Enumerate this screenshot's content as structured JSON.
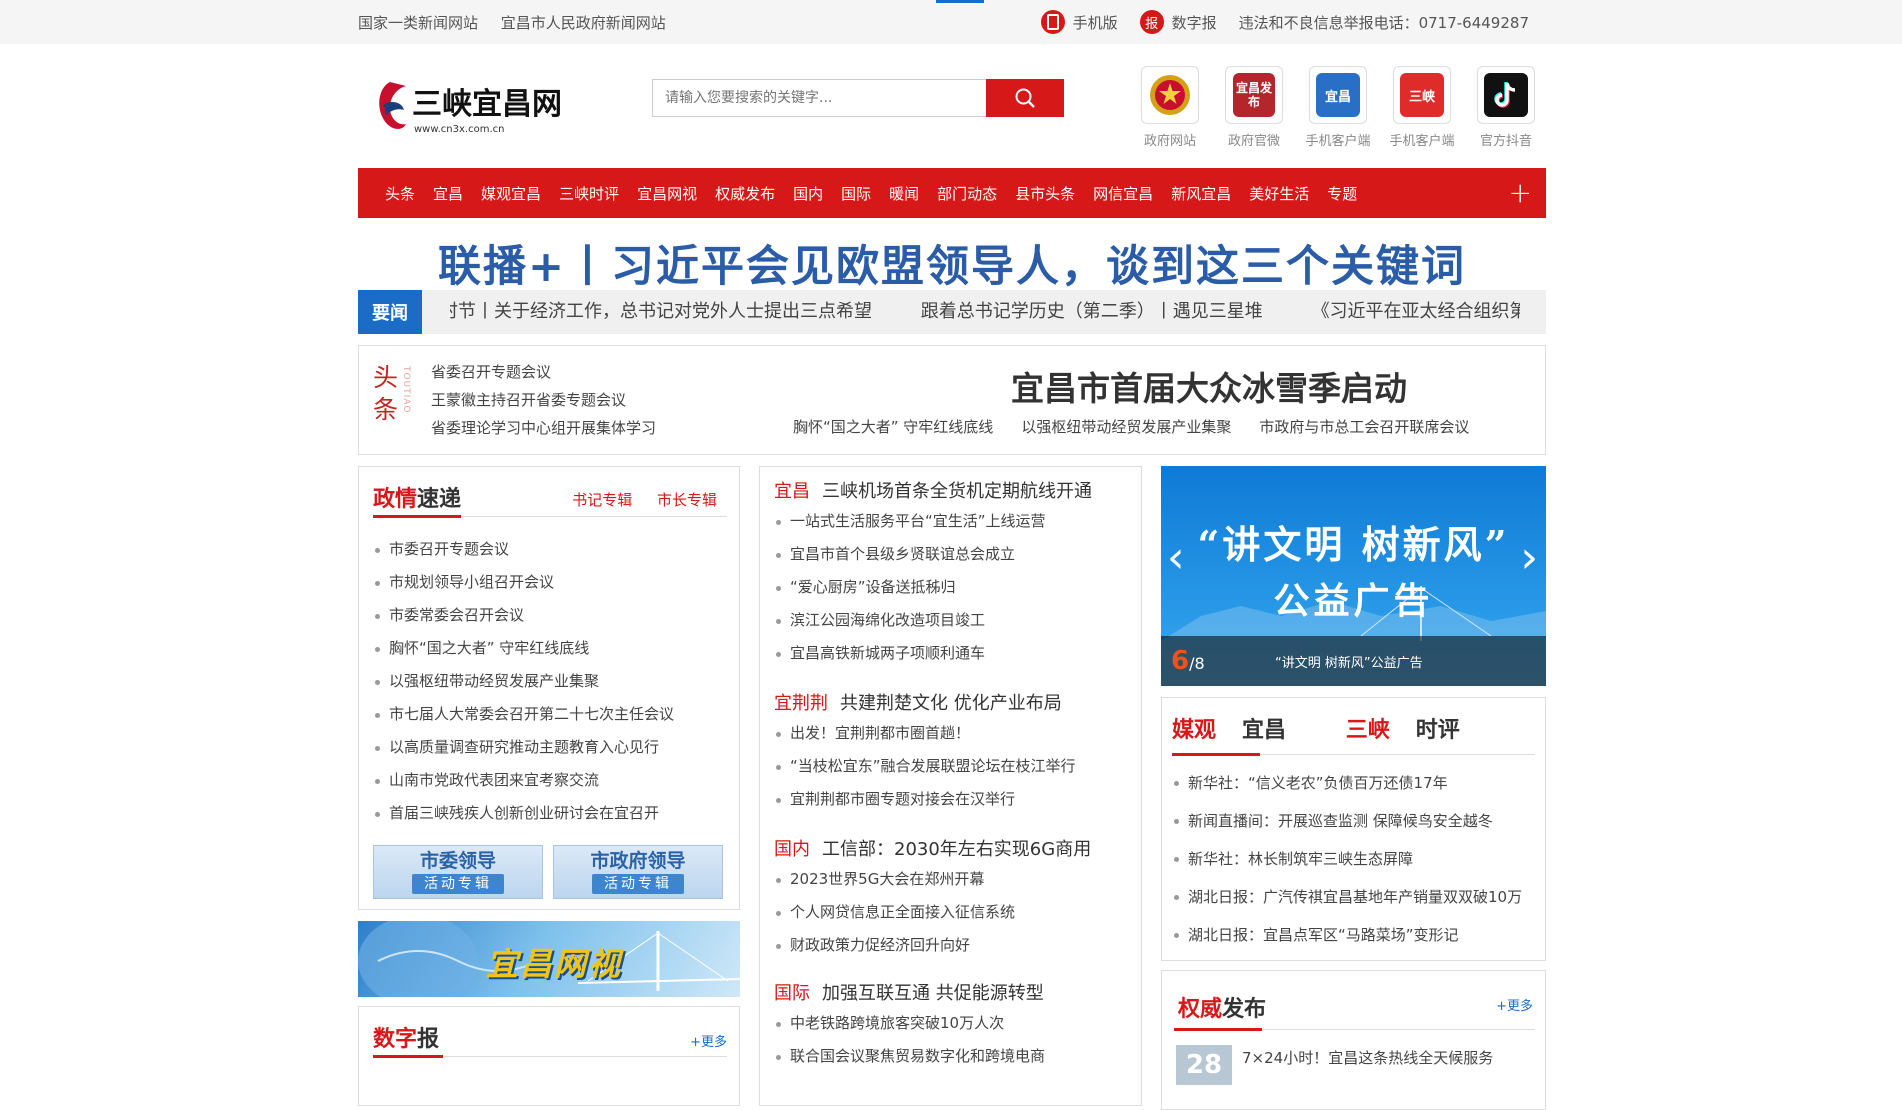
{
  "topbar": {
    "left_items": [
      "国家一类新闻网站",
      "宜昌市人民政府新闻网站"
    ],
    "mobile": "手机版",
    "digital_badge": "报",
    "digital": "数字报",
    "hotline": "违法和不良信息举报电话：0717-6449287"
  },
  "logo": {
    "text": "三峡宜昌网",
    "url_text": "www.cn3x.com.cn"
  },
  "search": {
    "placeholder": "请输入您要搜索的关键字..."
  },
  "apps": [
    {
      "label": "政府网站",
      "inner": "",
      "color": "#c8102e"
    },
    {
      "label": "政府官微",
      "inner": "宜昌发布",
      "color": "#b3262b"
    },
    {
      "label": "手机客户端",
      "inner": "宜昌",
      "color": "#2a6fc6"
    },
    {
      "label": "手机客户端",
      "inner": "三峡",
      "color": "#e02b2b"
    },
    {
      "label": "官方抖音",
      "inner": "",
      "color": "#111111"
    }
  ],
  "nav": [
    "头条",
    "宜昌",
    "媒观宜昌",
    "三峡时评",
    "宜昌网视",
    "权威发布",
    "国内",
    "国际",
    "暖闻",
    "部门动态",
    "县市头条",
    "网信宜昌",
    "新风宜昌",
    "美好生活",
    "专题"
  ],
  "headline": "联播+丨习近平会见欧盟领导人，谈到这三个关键词",
  "ticker": {
    "label": "要闻",
    "items": [
      "时节丨关于经济工作，总书记对党外人士提出三点希望",
      "跟着总书记学历史（第二季）丨遇见三星堆",
      "《习近平在亚太经合组织第"
    ]
  },
  "toutiao": {
    "badge_cn": "头条",
    "badge_en": "TOUTIAO",
    "list": [
      "省委召开专题会议",
      "王蒙徽主持召开省委专题会议",
      "省委理论学习中心组开展集体学习"
    ],
    "big": "宜昌市首届大众冰雪季启动",
    "sub": [
      "胸怀“国之大者” 守牢红线底线",
      "以强枢纽带动经贸发展产业集聚",
      "市政府与市总工会召开联席会议"
    ]
  },
  "zhengqing": {
    "title_red": "政情",
    "title_rest": "速递",
    "links": [
      "书记专辑",
      "市长专辑"
    ],
    "items": [
      "市委召开专题会议",
      "市规划领导小组召开会议",
      "市委常委会召开会议",
      "胸怀“国之大者” 守牢红线底线",
      "以强枢纽带动经贸发展产业集聚",
      "市七届人大常委会召开第二十七次主任会议",
      "以高质量调查研究推动主题教育入心见行",
      "山南市党政代表团来宜考察交流",
      "首届三峡残疾人创新创业研讨会在宜召开"
    ],
    "leaders": [
      {
        "a": "市委领导",
        "b": "活动专辑"
      },
      {
        "a": "市政府领导",
        "b": "活动专辑"
      }
    ]
  },
  "wangshi_banner": "宜昌网视",
  "shuzibao": {
    "title_red": "数字",
    "title_rest": "报",
    "more": "+更多"
  },
  "news_groups": [
    {
      "tag": "宜昌",
      "title": "三峡机场首条全货机定期航线开通",
      "items": [
        "一站式生活服务平台“宜生活”上线运营",
        "宜昌市首个县级乡贤联谊总会成立",
        "“爱心厨房”设备送抵秭归",
        "滨江公园海绵化改造项目竣工",
        "宜昌高铁新城两子项顺利通车"
      ]
    },
    {
      "tag": "宜荆荆",
      "title": "共建荆楚文化 优化产业布局",
      "items": [
        "出发！宜荆荆都市圈首趟！",
        "“当枝松宜东”融合发展联盟论坛在枝江举行",
        "宜荆荆都市圈专题对接会在汉举行"
      ]
    },
    {
      "tag": "国内",
      "title": "工信部：2030年左右实现6G商用",
      "items": [
        "2023世界5G大会在郑州开幕",
        "个人网贷信息正全面接入征信系统",
        "财政政策力促经济回升向好"
      ]
    },
    {
      "tag": "国际",
      "title": "加强互联互通 共促能源转型",
      "items": [
        "中老铁路跨境旅客突破10万人次",
        "联合国会议聚焦贸易数字化和跨境电商"
      ]
    }
  ],
  "slider": {
    "line1": "“讲文明 树新风”",
    "line2": "公益广告",
    "current": "6",
    "total": "/8",
    "caption": "“讲文明 树新风”公益广告"
  },
  "meiguan": {
    "tab1_red": "媒观",
    "tab1_rest": "宜昌",
    "tab2_red": "三峡",
    "tab2_rest": "时评",
    "items": [
      "新华社：“信义老农”负债百万还债17年",
      "新闻直播间：开展巡查监测 保障候鸟安全越冬",
      "新华社：林长制筑牢三峡生态屏障",
      "湖北日报：广汽传祺宜昌基地年产销量双双破10万",
      "湖北日报：宜昌点军区“马路菜场”变形记"
    ]
  },
  "quanwei": {
    "title_red": "权威",
    "title_rest": "发布",
    "more": "+更多",
    "day": "28",
    "news": "7×24小时！宜昌这条热线全天候服务"
  }
}
